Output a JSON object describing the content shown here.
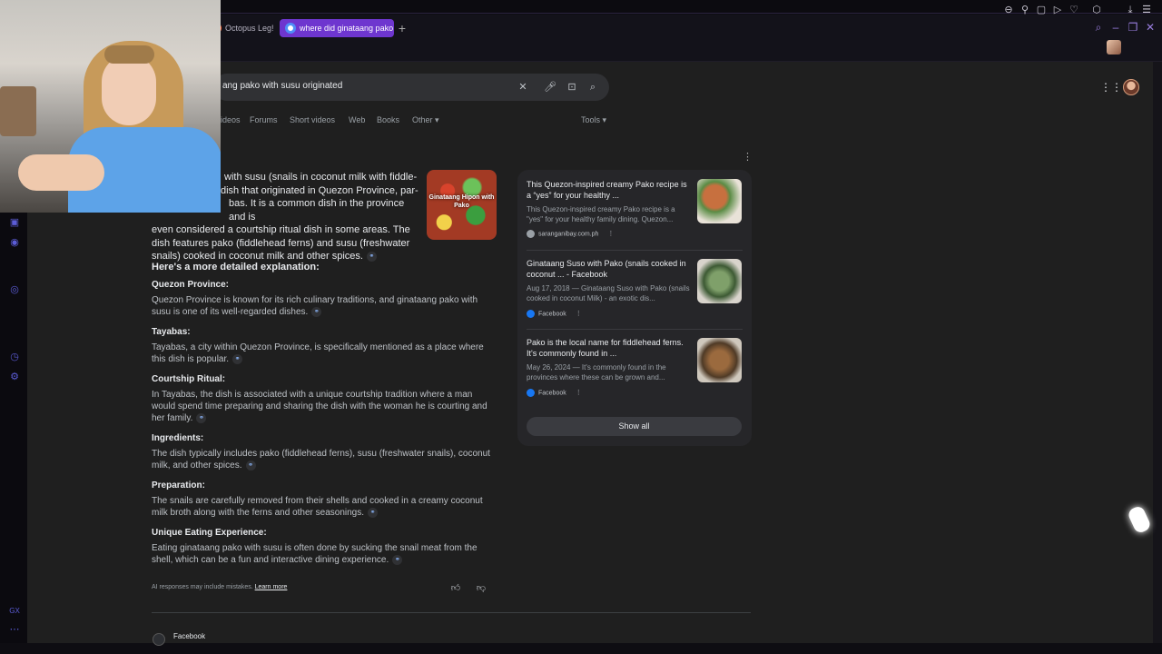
{
  "browser": {
    "tabs": [
      {
        "label": "Octopus Leg! M"
      },
      {
        "label": "where did ginataang pako"
      }
    ],
    "new_tab": "+"
  },
  "search": {
    "query": "ang pako with susu originated"
  },
  "filters": {
    "items": [
      "ideos",
      "Forums",
      "Short videos",
      "Web",
      "Books",
      "Other ▾"
    ],
    "tools": "Tools ▾"
  },
  "overview": {
    "intro": [
      "with susu (snails in coconut milk with fiddle-",
      "dish that originated in Quezon Province, par-",
      "bas. It is a common dish in the province and is",
      "even considered a courtship ritual dish in some areas. The",
      "dish features pako (fiddlehead ferns) and susu (freshwater",
      "snails) cooked in coconut milk and other spices."
    ],
    "image_caption": "Ginataang Hipon with Pako",
    "heading": "Here's a more detailed explanation:",
    "sections": [
      {
        "title": "Quezon Province:",
        "body": "Quezon Province is known for its rich culinary traditions, and ginataang pako with susu is one of its well-regarded dishes."
      },
      {
        "title": "Tayabas:",
        "body": "Tayabas, a city within Quezon Province, is specifically mentioned as a place where this dish is popular."
      },
      {
        "title": "Courtship Ritual:",
        "body": "In Tayabas, the dish is associated with a unique courtship tradition where a man would spend time preparing and sharing the dish with the woman he is courting and her family."
      },
      {
        "title": "Ingredients:",
        "body": "The dish typically includes pako (fiddlehead ferns), susu (freshwater snails), coconut milk, and other spices."
      },
      {
        "title": "Preparation:",
        "body": "The snails are carefully removed from their shells and cooked in a creamy coconut milk broth along with the ferns and other seasonings."
      },
      {
        "title": "Unique Eating Experience:",
        "body": "Eating ginataang pako with susu is often done by sucking the snail meat from the shell, which can be a fun and interactive dining experience."
      }
    ],
    "disclaimer": "AI responses may include mistakes.",
    "learn_more": "Learn more"
  },
  "sources": {
    "cards": [
      {
        "title": "This Quezon-inspired creamy Pako recipe is a “yes” for your healthy ...",
        "snippet": "This Quezon-inspired creamy Pako recipe is a \"yes\" for your healthy family dining. Quezon...",
        "source": "saranganibay.com.ph",
        "icon_color": "#9aa0a6",
        "thumb_color": "#b55a3c"
      },
      {
        "title": "Ginataang Suso with Pako (snails cooked in coconut ... - Facebook",
        "snippet": "Aug 17, 2018 — Ginataang Suso with Pako (snails cooked in coconut Milk) - an exotic dis...",
        "source": "Facebook",
        "icon_color": "#1877f2",
        "thumb_color": "#6f8f5c"
      },
      {
        "title": "Pako is the local name for fiddlehead ferns. It's commonly found in ...",
        "snippet": "May 26, 2024 — It's commonly found in the provinces where these can be grown and...",
        "source": "Facebook",
        "icon_color": "#1877f2",
        "thumb_color": "#8a5b34"
      }
    ],
    "show_all": "Show all"
  },
  "bottom_result": {
    "source": "Facebook"
  },
  "colors": {
    "accent": "#6e36cf",
    "link": "#8ab4f8",
    "page_bg": "#1f1f1f"
  }
}
